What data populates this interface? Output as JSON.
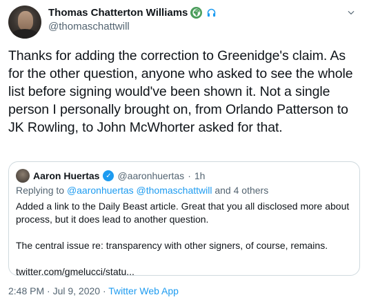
{
  "author": {
    "display_name": "Thomas Chatterton Williams",
    "handle": "@thomaschattwill",
    "badges": [
      "globe-icon",
      "headphones-icon"
    ]
  },
  "tweet": {
    "text": "Thanks for adding the correction to Greenidge's claim. As for the other question, anyone who asked to see the whole list before signing would've been shown it. Not a single person I personally brought on, from Orlando Patterson to JK Rowling, to John McWhorter asked for that."
  },
  "quoted": {
    "display_name": "Aaron Huertas",
    "handle": "@aaronhuertas",
    "separator": "·",
    "time": "1h",
    "reply_prefix": "Replying to",
    "reply_mentions": "@aaronhuertas @thomaschattwill",
    "reply_suffix": "and 4 others",
    "paragraphs": [
      "Added a link to the Daily Beast article. Great that you all disclosed more about process, but it does lead to another question.",
      "The central issue re: transparency with other signers, of course, remains.",
      "twitter.com/gmelucci/statu..."
    ]
  },
  "meta": {
    "timestamp": "2:48 PM · Jul 9, 2020",
    "separator": "·",
    "source": "Twitter Web App"
  },
  "colors": {
    "accent": "#1d9bf0",
    "secondary_text": "#536471",
    "border": "#cfd9de"
  }
}
